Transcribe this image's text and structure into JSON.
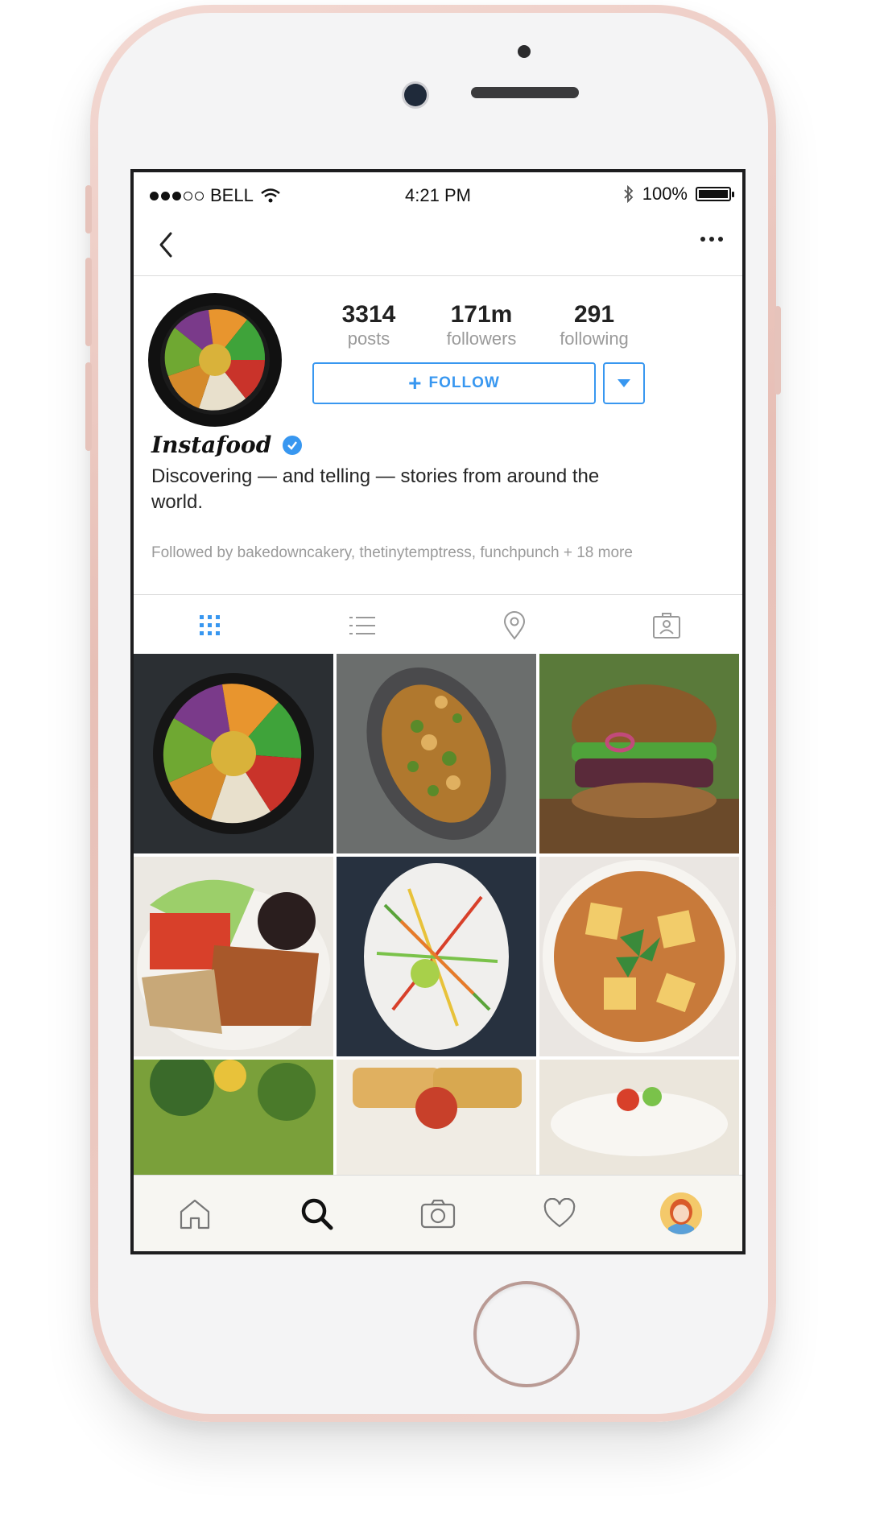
{
  "status_bar": {
    "carrier": "BELL",
    "time": "4:21 PM",
    "battery": "100%"
  },
  "profile": {
    "stats": [
      {
        "value": "3314",
        "label": "posts"
      },
      {
        "value": "171m",
        "label": "followers"
      },
      {
        "value": "291",
        "label": "following"
      }
    ],
    "follow_label": "FOLLOW",
    "follow_plus": "+",
    "name": "Instafood",
    "bio": "Discovering — and telling — stories from around the world.",
    "followed_by": "Followed by bakedowncakery, thetinytemptress, funchpunch + 18 more"
  },
  "tabs": [
    "grid-icon",
    "list-icon",
    "location-pin-icon",
    "tagged-person-icon"
  ],
  "grid_photos": [
    {
      "subject": "buddha bowl",
      "color": "#2b2f33"
    },
    {
      "subject": "cauliflower dish",
      "color": "#6b6e6d"
    },
    {
      "subject": "veggie burger",
      "color": "#7a5a3a"
    },
    {
      "subject": "chicken rice bowl",
      "color": "#c8b89a"
    },
    {
      "subject": "noodle salad",
      "color": "#27313f"
    },
    {
      "subject": "paneer curry",
      "color": "#c87a3a"
    },
    {
      "subject": "kale salad",
      "color": "#6a8a3a"
    },
    {
      "subject": "crostini",
      "color": "#d8b070"
    },
    {
      "subject": "salad bowl",
      "color": "#d9d3cb"
    }
  ],
  "bottom_nav": [
    "home-icon",
    "search-icon",
    "camera-icon",
    "heart-icon",
    "profile-avatar"
  ],
  "colors": {
    "accent": "#3897f0",
    "phone_frame": "#e7bfb6"
  }
}
